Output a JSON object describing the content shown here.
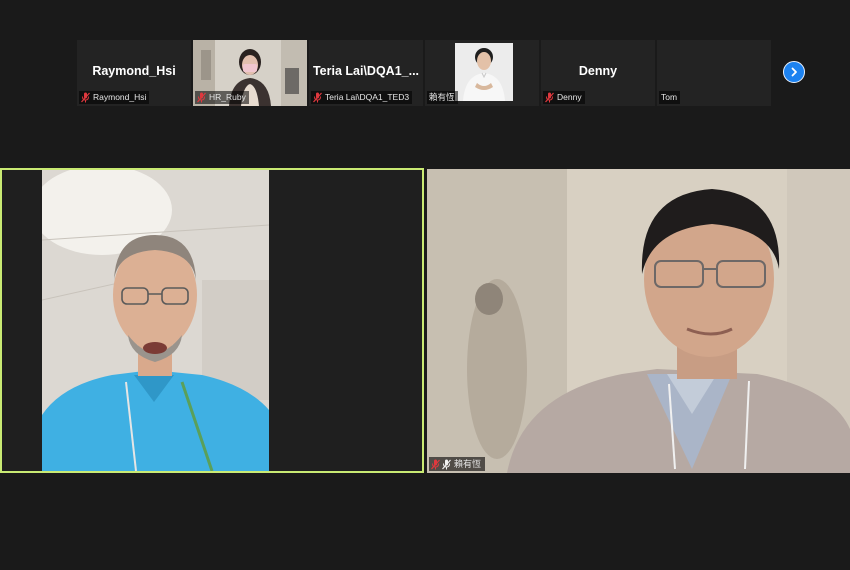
{
  "thumbnails": [
    {
      "display_name": "Raymond_Hsi",
      "label": "Raymond_Hsi",
      "muted": true,
      "has_video": false
    },
    {
      "display_name": "",
      "label": "HR_Ruby",
      "muted": true,
      "has_video": true
    },
    {
      "display_name": "Teria  Lai\\DQA1_...",
      "label": "Teria Lai\\DQA1_TED3",
      "muted": true,
      "has_video": false
    },
    {
      "display_name": "",
      "label": "賴有恆",
      "muted": false,
      "has_video": true
    },
    {
      "display_name": "Denny",
      "label": "Denny",
      "muted": true,
      "has_video": false
    },
    {
      "display_name": "",
      "label": "Tom",
      "muted": false,
      "has_video": false
    }
  ],
  "main_videos": [
    {
      "label": "",
      "active_speaker": true
    },
    {
      "label": "賴有恆",
      "muted": true,
      "active_speaker": false
    }
  ],
  "colors": {
    "background": "#1a1a1a",
    "tile": "#232323",
    "active_speaker_border": "#c9ea73",
    "mute_icon": "#e0383e",
    "next_button": "#1c82f0"
  },
  "icons": {
    "muted": "mic-muted-icon",
    "next": "chevron-right-icon"
  }
}
